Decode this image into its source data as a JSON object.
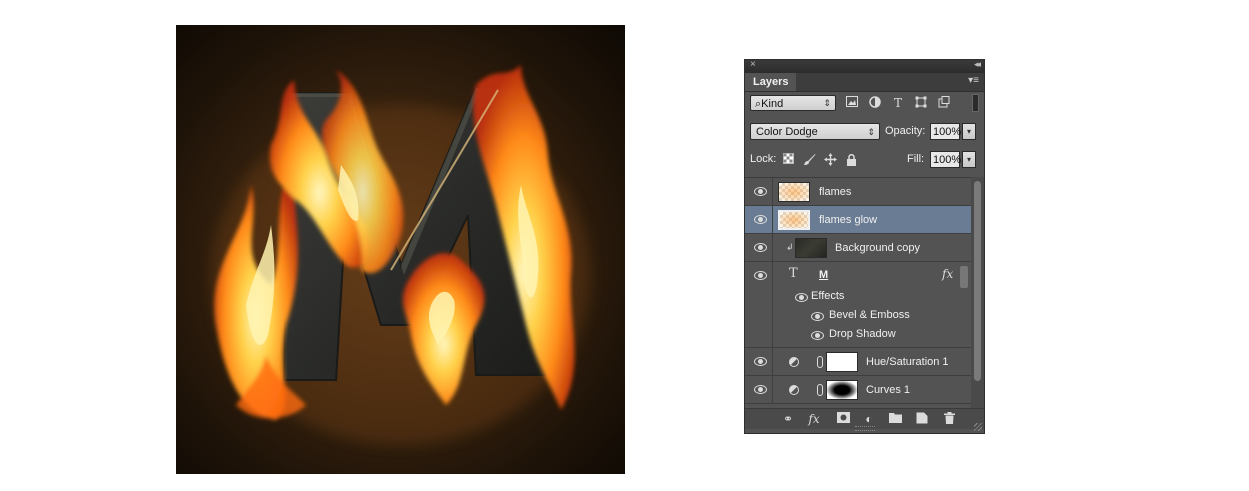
{
  "panel": {
    "close_glyph": "×",
    "collapse_glyph": "◂◂",
    "tab_label": "Layers",
    "menu_glyph": "▾≡",
    "filter": {
      "kind_label": "Kind",
      "search_glyph": "⌕",
      "arrows": "⇕",
      "icons": [
        "image-filter-icon",
        "adjustment-filter-icon",
        "type-filter-icon",
        "shape-filter-icon",
        "smart-object-filter-icon"
      ],
      "type_glyph": "T"
    },
    "blend": {
      "mode": "Color Dodge",
      "arrows": "⇕",
      "opacity_label": "Opacity:",
      "opacity_value": "100%",
      "drop_glyph": "▾"
    },
    "lock": {
      "label": "Lock:",
      "fill_label": "Fill:",
      "fill_value": "100%",
      "drop_glyph": "▾"
    },
    "layers": [
      {
        "name": "flames",
        "selected": false
      },
      {
        "name": "flames glow",
        "selected": true
      },
      {
        "name": "Background copy",
        "clipped": true
      },
      {
        "name": "M",
        "type": "text",
        "fx": "fx"
      },
      {
        "name": "Effects"
      },
      {
        "name": "Bevel & Emboss"
      },
      {
        "name": "Drop Shadow"
      },
      {
        "name": "Hue/Saturation 1",
        "type": "adjustment"
      },
      {
        "name": "Curves 1",
        "type": "adjustment"
      }
    ],
    "type_glyph": "T",
    "clip_glyph": "↲",
    "footer": {
      "link_glyph": "⚭",
      "fx_glyph": "fx",
      "mask_glyph": "◘",
      "adjust_glyph": "◐",
      "folder_glyph": "▬",
      "new_glyph": "▣",
      "trash_glyph": "🗑"
    }
  },
  "colors": {
    "panel_bg": "#535353",
    "selected_row": "#6a7c94"
  }
}
